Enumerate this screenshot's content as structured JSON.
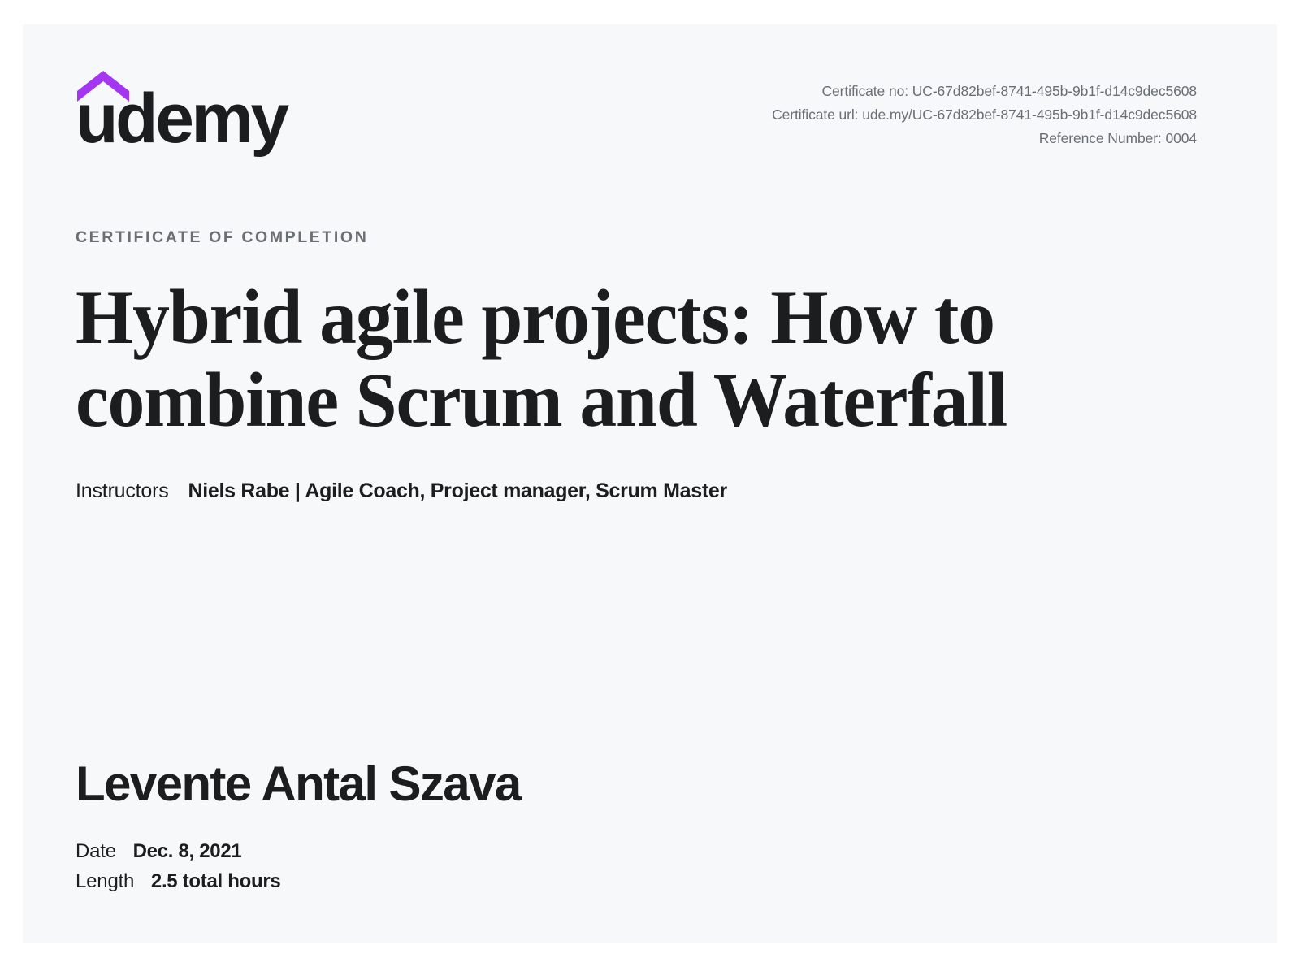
{
  "document": {
    "type": "certificate-of-completion",
    "background_color": "#f7f8fa",
    "accent_color": "#a435f0",
    "text_color": "#1c1d1f",
    "muted_text_color": "#6a6f73"
  },
  "header": {
    "logo": {
      "wordmark": "udemy",
      "caret_icon": "udemy-caret-icon",
      "caret_color": "#a435f0"
    },
    "meta": {
      "certificate_no": "Certificate no: UC-67d82bef-8741-495b-9b1f-d14c9dec5608",
      "certificate_url": "Certificate url: ude.my/UC-67d82bef-8741-495b-9b1f-d14c9dec5608",
      "reference_number": "Reference Number: 0004"
    }
  },
  "main": {
    "eyebrow": "CERTIFICATE OF COMPLETION",
    "course_title": "Hybrid agile projects: How to combine Scrum and Waterfall",
    "instructors": {
      "label": "Instructors",
      "value": "Niels Rabe | Agile Coach, Project manager, Scrum Master"
    }
  },
  "footer": {
    "recipient_name": "Levente Antal Szava",
    "date": {
      "label": "Date",
      "value": "Dec. 8, 2021"
    },
    "length": {
      "label": "Length",
      "value": "2.5 total hours"
    }
  }
}
